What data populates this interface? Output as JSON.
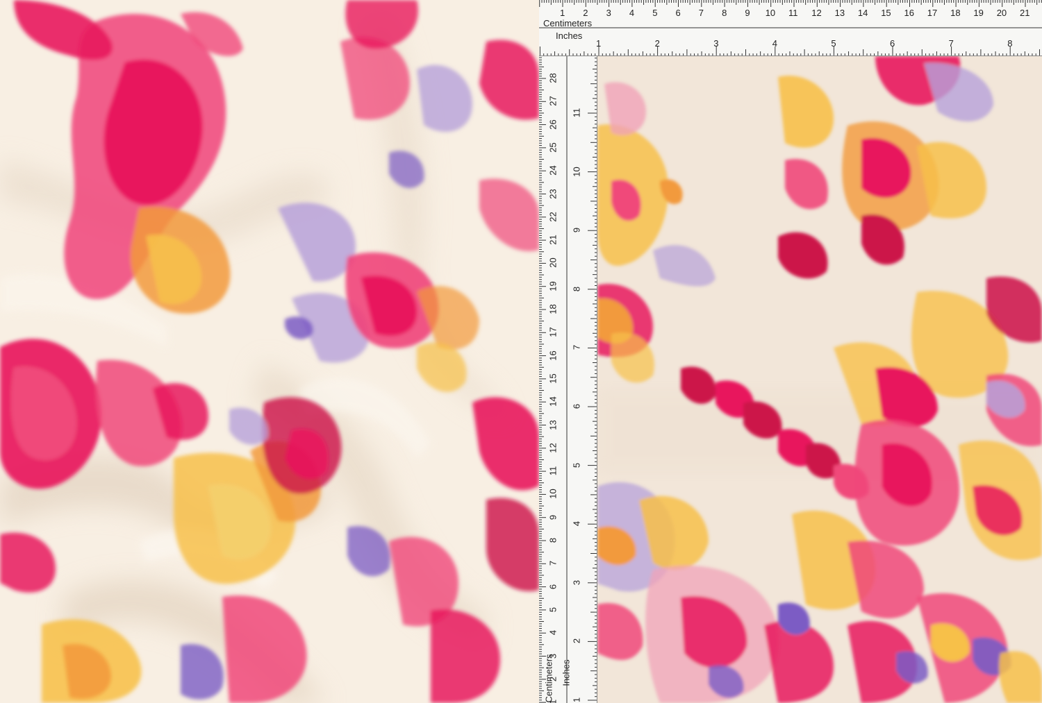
{
  "image": {
    "description_kind": "product photo",
    "colors": {
      "background": "#f8efe3",
      "magenta": "#e8175d",
      "hot_pink": "#f0487a",
      "crimson": "#cc1248",
      "yellow": "#f7c04a",
      "orange": "#f29a3c",
      "lavender": "#b7a1d9",
      "violet": "#7b5cc4",
      "ruler_bg": "#f7f7f5"
    }
  },
  "ruler_top": {
    "centimeters_label": "Centimeters",
    "inches_label": "Inches",
    "cm_numbers": [
      "1",
      "2",
      "3",
      "4",
      "5",
      "6",
      "7",
      "8",
      "9",
      "10",
      "11",
      "12",
      "13",
      "14",
      "15",
      "16",
      "17",
      "18",
      "19",
      "20",
      "21"
    ],
    "inch_numbers": [
      "1",
      "2",
      "3",
      "4",
      "5",
      "6",
      "7",
      "8"
    ]
  },
  "ruler_side": {
    "centimeters_label": "Centimeters",
    "inches_label": "Inches",
    "cm_numbers": [
      "28",
      "27",
      "26",
      "25",
      "24",
      "23",
      "22",
      "21",
      "20",
      "19",
      "18",
      "17",
      "16",
      "15",
      "14",
      "13",
      "12",
      "11",
      "10",
      "9",
      "8",
      "7",
      "6",
      "5",
      "4",
      "3",
      "2",
      "1"
    ],
    "inch_numbers": [
      "11",
      "10",
      "9",
      "8",
      "7",
      "6",
      "5",
      "4",
      "3",
      "2",
      "1"
    ]
  }
}
